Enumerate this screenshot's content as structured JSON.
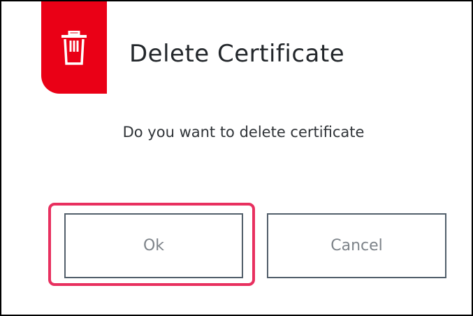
{
  "dialog": {
    "title": "Delete Certificate",
    "icon": "trash-icon",
    "message": "Do you want to delete certificate",
    "buttons": {
      "ok_label": "Ok",
      "cancel_label": "Cancel"
    },
    "focused_button": "ok"
  },
  "colors": {
    "accent_red": "#ea0016",
    "focus_ring": "#e8305f",
    "button_border": "#525f6b",
    "title_text": "#23272b"
  }
}
